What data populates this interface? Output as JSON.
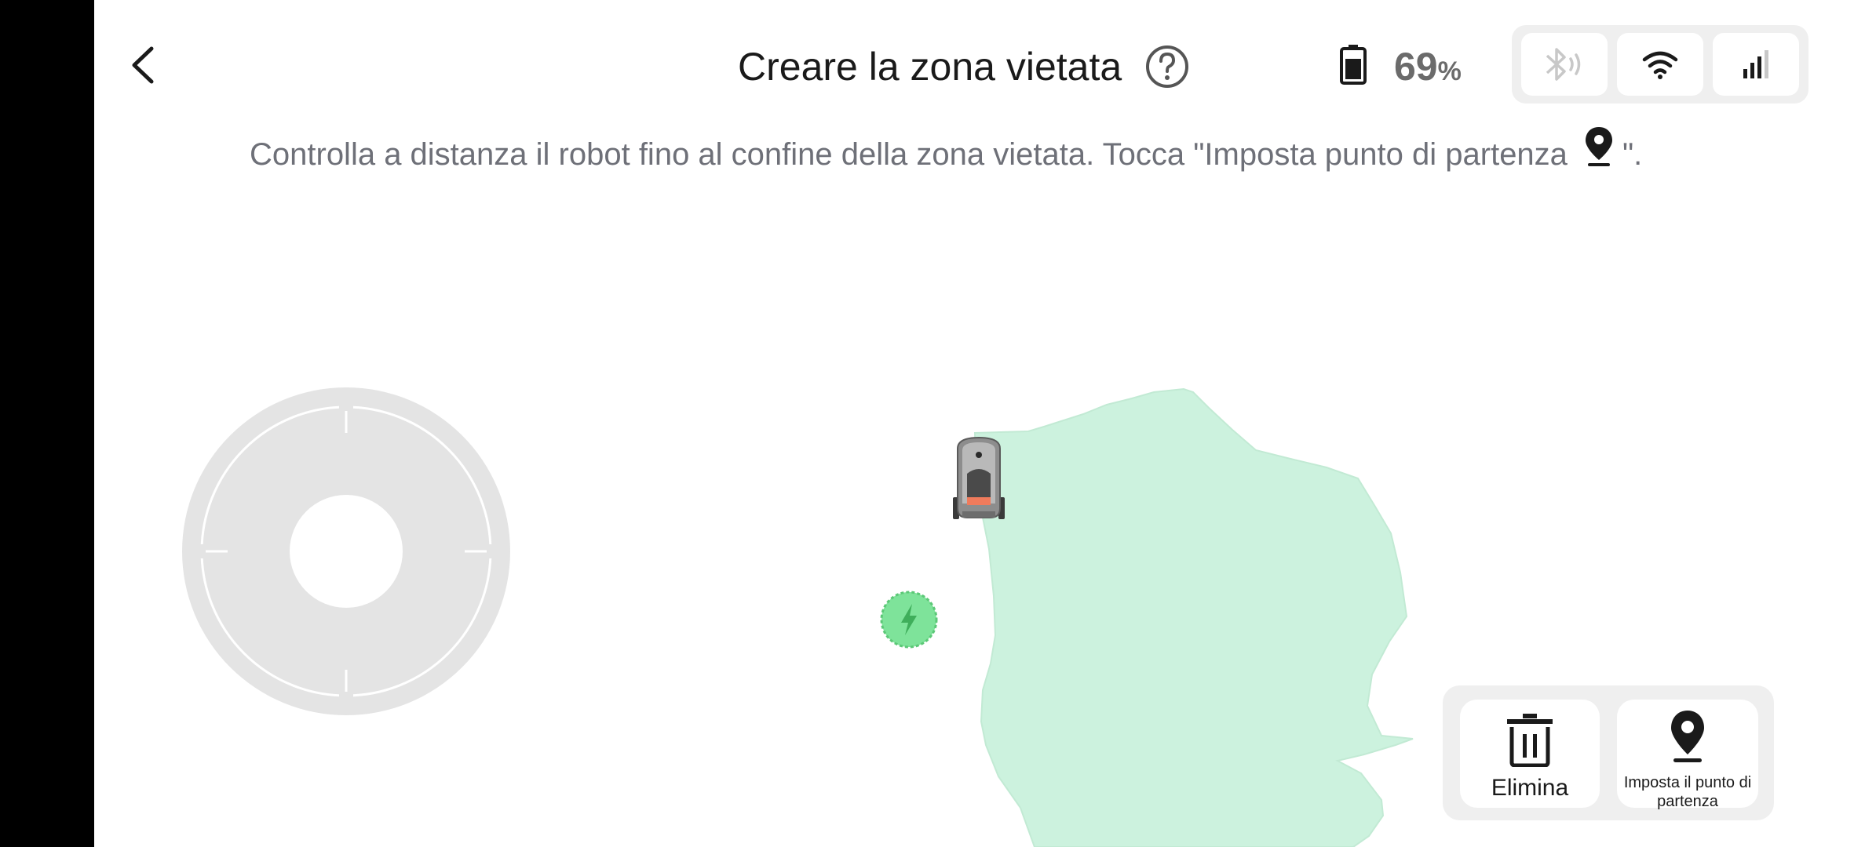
{
  "header": {
    "back_icon": "chevron-left-icon",
    "title": "Creare la zona vietata",
    "help_icon": "question-circle-icon"
  },
  "status": {
    "battery_icon": "battery-icon",
    "battery_value": "69",
    "battery_unit": "%",
    "bluetooth_icon": "bluetooth-icon",
    "wifi_icon": "wifi-icon",
    "cellular_icon": "cellular-signal-icon"
  },
  "instruction": {
    "text_before": "Controlla a distanza il robot fino al confine della zona vietata. Tocca \"Imposta punto di partenza",
    "text_after": "\".",
    "inline_icon": "location-pin-icon"
  },
  "map": {
    "lawn_color": "#ccf2de",
    "robot_icon": "robot-mower-icon",
    "charger_icon": "charging-station-icon",
    "charger_color": "#7ee39a"
  },
  "joystick": {
    "icon": "joystick-control"
  },
  "actions": {
    "delete_label": "Elimina",
    "delete_icon": "trash-icon",
    "set_start_label": "Imposta il punto di partenza",
    "set_start_icon": "location-pin-icon"
  }
}
